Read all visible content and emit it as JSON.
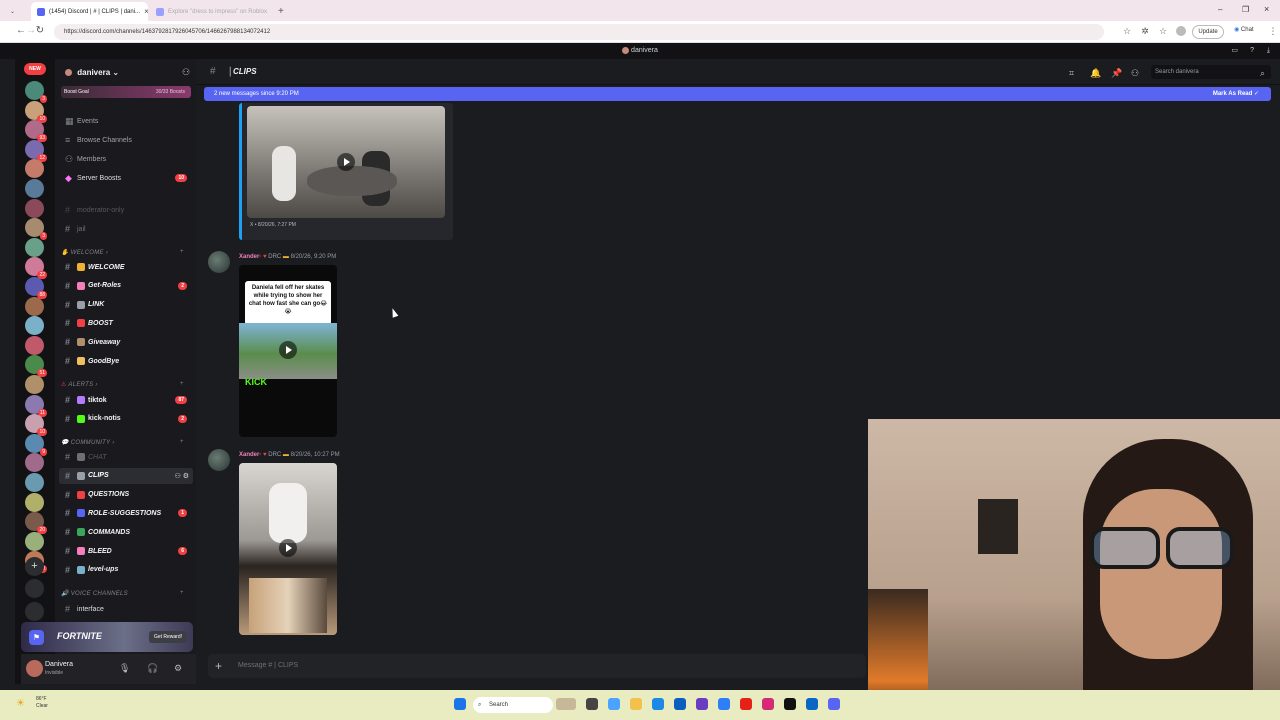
{
  "browser": {
    "tabs": [
      {
        "label": "(1454) Discord | # | CLIPS | dani...",
        "active": true
      },
      {
        "label": "Explore \"dress to impress\" on Roblox",
        "active": false
      }
    ],
    "url": "https://discord.com/channels/1463792817926045706/1466267988134072412",
    "update_label": "Update",
    "chat_label": "Chat"
  },
  "app_title": "danivera",
  "rail": {
    "new_label": "NEW",
    "badges": [
      "3",
      "10",
      "93",
      "12",
      "",
      "",
      "",
      "3",
      "",
      "22",
      "88",
      "",
      "",
      "",
      "51",
      "",
      "11",
      "10",
      "9",
      "",
      "",
      "",
      "20",
      "",
      "10"
    ]
  },
  "sidebar": {
    "server_name": "danivera",
    "boost_goal": "Boost Goal",
    "boost_count": "30/33 Boosts",
    "top_items": [
      {
        "label": "Events"
      },
      {
        "label": "Browse Channels"
      },
      {
        "label": "Members"
      },
      {
        "label": "Server Boosts",
        "badge": "10"
      }
    ],
    "locked_channels": [
      "moderator-only",
      "jail"
    ],
    "cat_welcome": "WELCOME",
    "welcome_channels": [
      {
        "label": "WELCOME",
        "badge": ""
      },
      {
        "label": "Get-Roles",
        "badge": "2"
      },
      {
        "label": "LINK",
        "badge": ""
      },
      {
        "label": "BOOST",
        "badge": ""
      },
      {
        "label": "Giveaway",
        "badge": ""
      },
      {
        "label": "GoodBye",
        "badge": ""
      }
    ],
    "cat_alerts": "ALERTS",
    "alert_channels": [
      {
        "label": "tiktok",
        "badge": "87"
      },
      {
        "label": "kick-notis",
        "badge": "2"
      }
    ],
    "cat_community": "COMMUNITY",
    "community_channels": [
      {
        "label": "CHAT",
        "badge": ""
      },
      {
        "label": "CLIPS",
        "badge": ""
      },
      {
        "label": "QUESTIONS",
        "badge": ""
      },
      {
        "label": "ROLE-SUGGESTIONS",
        "badge": "1"
      },
      {
        "label": "COMMANDS",
        "badge": ""
      },
      {
        "label": "BLEED",
        "badge": "6"
      },
      {
        "label": "level-ups",
        "badge": ""
      }
    ],
    "cat_voice": "VOICE CHANNELS",
    "voice_channels": [
      {
        "label": "interface"
      }
    ],
    "promo": {
      "title": "FORTNITE",
      "button": "Get Reward!"
    },
    "user": {
      "name": "Danivera",
      "status": "Invisible"
    }
  },
  "chat": {
    "channel_name": "CLIPS",
    "search_placeholder": "Search danivera",
    "new_messages": "2 new messages since 9:20 PM",
    "mark_as_read": "Mark As Read",
    "embed_footer": "X • 8/20/26, 7:27 PM",
    "messages": [
      {
        "author": "Xander·",
        "tag": "DRC",
        "time": "8/20/26, 9:20 PM",
        "caption": "Daniela fell off her skates while trying to show her chat how fast she can go😂😭",
        "brand": "KICK"
      },
      {
        "author": "Xander·",
        "tag": "DRC",
        "time": "8/20/26, 10:27 PM",
        "caption": "",
        "brand": ""
      }
    ],
    "composer_placeholder": "Message # | CLIPS"
  },
  "taskbar": {
    "weather_temp": "86°F",
    "weather_desc": "Clear",
    "search_label": "Search"
  },
  "colors": {
    "accent": "#5865f2",
    "badge": "#f23f43",
    "author": "#f47fba",
    "embed_border": "#1da1f2"
  }
}
